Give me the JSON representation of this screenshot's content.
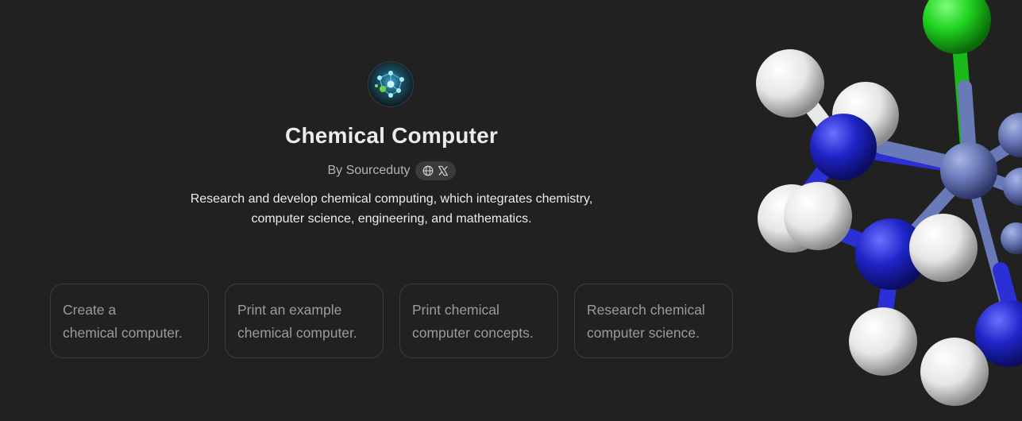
{
  "gpt": {
    "avatar_icon": "chemical-network-avatar",
    "title": "Chemical Computer",
    "byline": "By Sourceduty",
    "social_icons": [
      "globe-icon",
      "x-icon"
    ],
    "description_line1": "Research and develop chemical computing, which integrates chemistry,",
    "description_line2": "computer science, engineering, and mathematics."
  },
  "starters": [
    {
      "line1": "Create a",
      "line2": "chemical computer."
    },
    {
      "line1": "Print an example",
      "line2": "chemical computer."
    },
    {
      "line1": "Print chemical",
      "line2": "computer concepts."
    },
    {
      "line1": "Research chemical",
      "line2": "computer science."
    }
  ],
  "colors": {
    "background": "#212121",
    "text": "#ececec",
    "muted_text": "#b4b4b4",
    "starter_text": "#9b9b9b",
    "card_border": "#3c3c3c",
    "atom_white": "#f2f2f2",
    "atom_blue": "#1f24c8",
    "atom_metal": "#6a79b8",
    "atom_chlorine": "#1ed21e"
  },
  "illustration": "ball-and-stick-molecule-image"
}
